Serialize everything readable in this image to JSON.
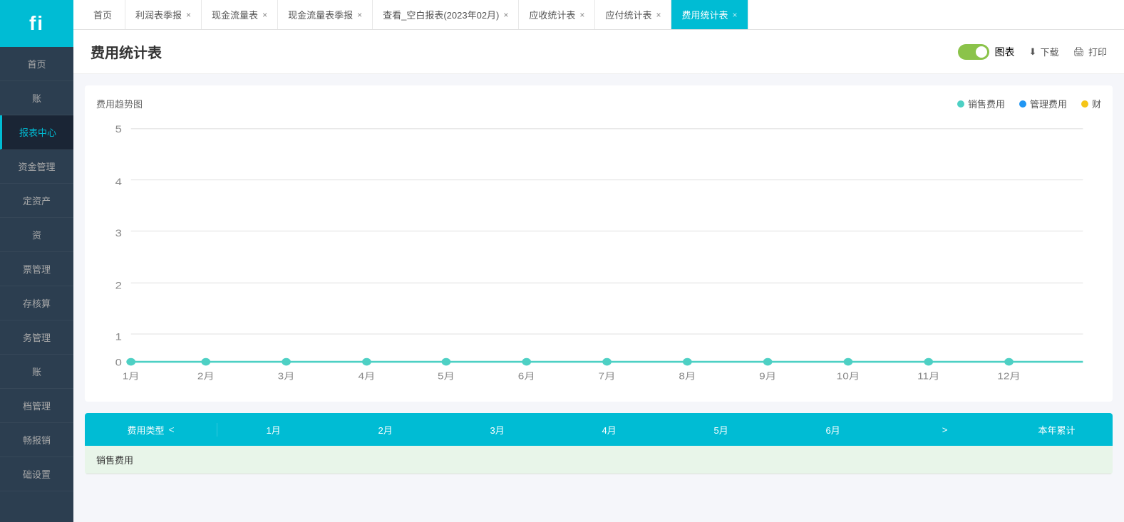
{
  "app": {
    "logo": "fi"
  },
  "sidebar": {
    "items": [
      {
        "id": "home",
        "label": "首页",
        "active": false
      },
      {
        "id": "account",
        "label": "账",
        "active": false
      },
      {
        "id": "report-center",
        "label": "报表中心",
        "active": true
      },
      {
        "id": "fund-management",
        "label": "资金管理",
        "active": false
      },
      {
        "id": "fixed-assets",
        "label": "定资产",
        "active": false
      },
      {
        "id": "assets",
        "label": "资",
        "active": false
      },
      {
        "id": "ticket-management",
        "label": "票管理",
        "active": false
      },
      {
        "id": "inventory",
        "label": "存核算",
        "active": false
      },
      {
        "id": "service-management",
        "label": "务管理",
        "active": false
      },
      {
        "id": "ledger",
        "label": "账",
        "active": false
      },
      {
        "id": "archive-management",
        "label": "档管理",
        "active": false
      },
      {
        "id": "sales",
        "label": "畅报销",
        "active": false
      },
      {
        "id": "settings",
        "label": "础设置",
        "active": false
      }
    ]
  },
  "tabs": {
    "home": "首页",
    "items": [
      {
        "id": "profit-quarterly",
        "label": "利润表季报",
        "closable": true
      },
      {
        "id": "cashflow",
        "label": "现金流量表",
        "closable": true
      },
      {
        "id": "cashflow-quarterly",
        "label": "现金流量表季报",
        "closable": true
      },
      {
        "id": "blank-report",
        "label": "查看_空白报表(2023年02月)",
        "closable": true
      },
      {
        "id": "receivable-stats",
        "label": "应收统计表",
        "closable": true
      },
      {
        "id": "payable-stats",
        "label": "应付统计表",
        "closable": true
      },
      {
        "id": "expense-stats",
        "label": "费用统计表",
        "closable": true,
        "active": true
      }
    ]
  },
  "page": {
    "title": "费用统计表",
    "toggle_label": "图表",
    "download_label": "下载",
    "print_label": "打印"
  },
  "chart": {
    "title": "费用趋势图",
    "legend": [
      {
        "id": "sales-expense",
        "label": "销售费用",
        "color": "#4dd0c4"
      },
      {
        "id": "admin-expense",
        "label": "管理费用",
        "color": "#2196f3"
      },
      {
        "id": "finance-expense",
        "label": "财",
        "color": "#f5c518"
      }
    ],
    "y_axis": [
      "5",
      "4",
      "3",
      "2",
      "1",
      "0"
    ],
    "x_axis": [
      "1月",
      "2月",
      "3月",
      "4月",
      "5月",
      "6月",
      "7月",
      "8月",
      "9月",
      "10月",
      "11月",
      "12月"
    ]
  },
  "table": {
    "header": {
      "type_col": "费用类型",
      "months": [
        "1月",
        "2月",
        "3月",
        "4月",
        "5月",
        "6月"
      ],
      "summary": "本年累计",
      "prev_left": "<",
      "prev_right": ">"
    },
    "rows": [
      {
        "type": "销售费用",
        "values": [
          "",
          "",
          "",
          "",
          "",
          ""
        ]
      }
    ]
  }
}
